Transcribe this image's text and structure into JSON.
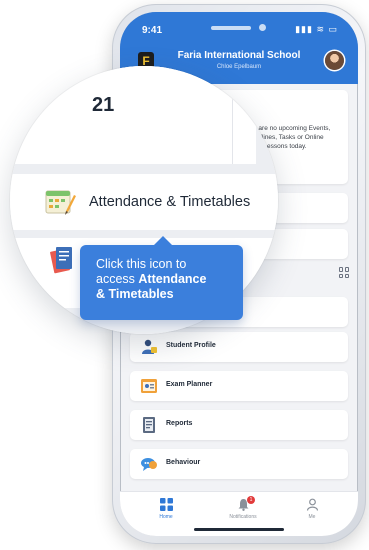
{
  "status_bar": {
    "time": "9:41",
    "icons": "▮▮▮ ≋ ▭"
  },
  "header": {
    "logo_letter": "F",
    "school_name": "Faria International School",
    "user_name": "Chloe Epelbaum"
  },
  "events": {
    "lines": [
      "There are no upcoming Events,",
      "Deadlines, Tasks or Online",
      "Lessons today."
    ]
  },
  "attendance_card_tail": "bles",
  "menu": [
    {
      "label": "Student Profile",
      "icon": "student-profile-icon"
    },
    {
      "label": "Exam Planner",
      "icon": "exam-planner-icon"
    },
    {
      "label": "Reports",
      "icon": "reports-icon"
    },
    {
      "label": "Behaviour",
      "icon": "behaviour-icon"
    }
  ],
  "tabbar": [
    {
      "label": "Home",
      "icon": "home-icon",
      "active": true
    },
    {
      "label": "Notifications",
      "icon": "bell-icon",
      "badge": "1"
    },
    {
      "label": "Me",
      "icon": "user-icon"
    }
  ],
  "magnifier": {
    "date": "21",
    "attendance_label": "Attendance & Timetables"
  },
  "tooltip": {
    "line1": "Click this icon to",
    "line2_prefix": "access ",
    "line2_bold": "Attendance",
    "line3_bold": "& Timetables"
  },
  "colors": {
    "brand_blue": "#2f78d6",
    "tooltip_blue": "#3b7fdc",
    "badge_red": "#e23b3b"
  }
}
